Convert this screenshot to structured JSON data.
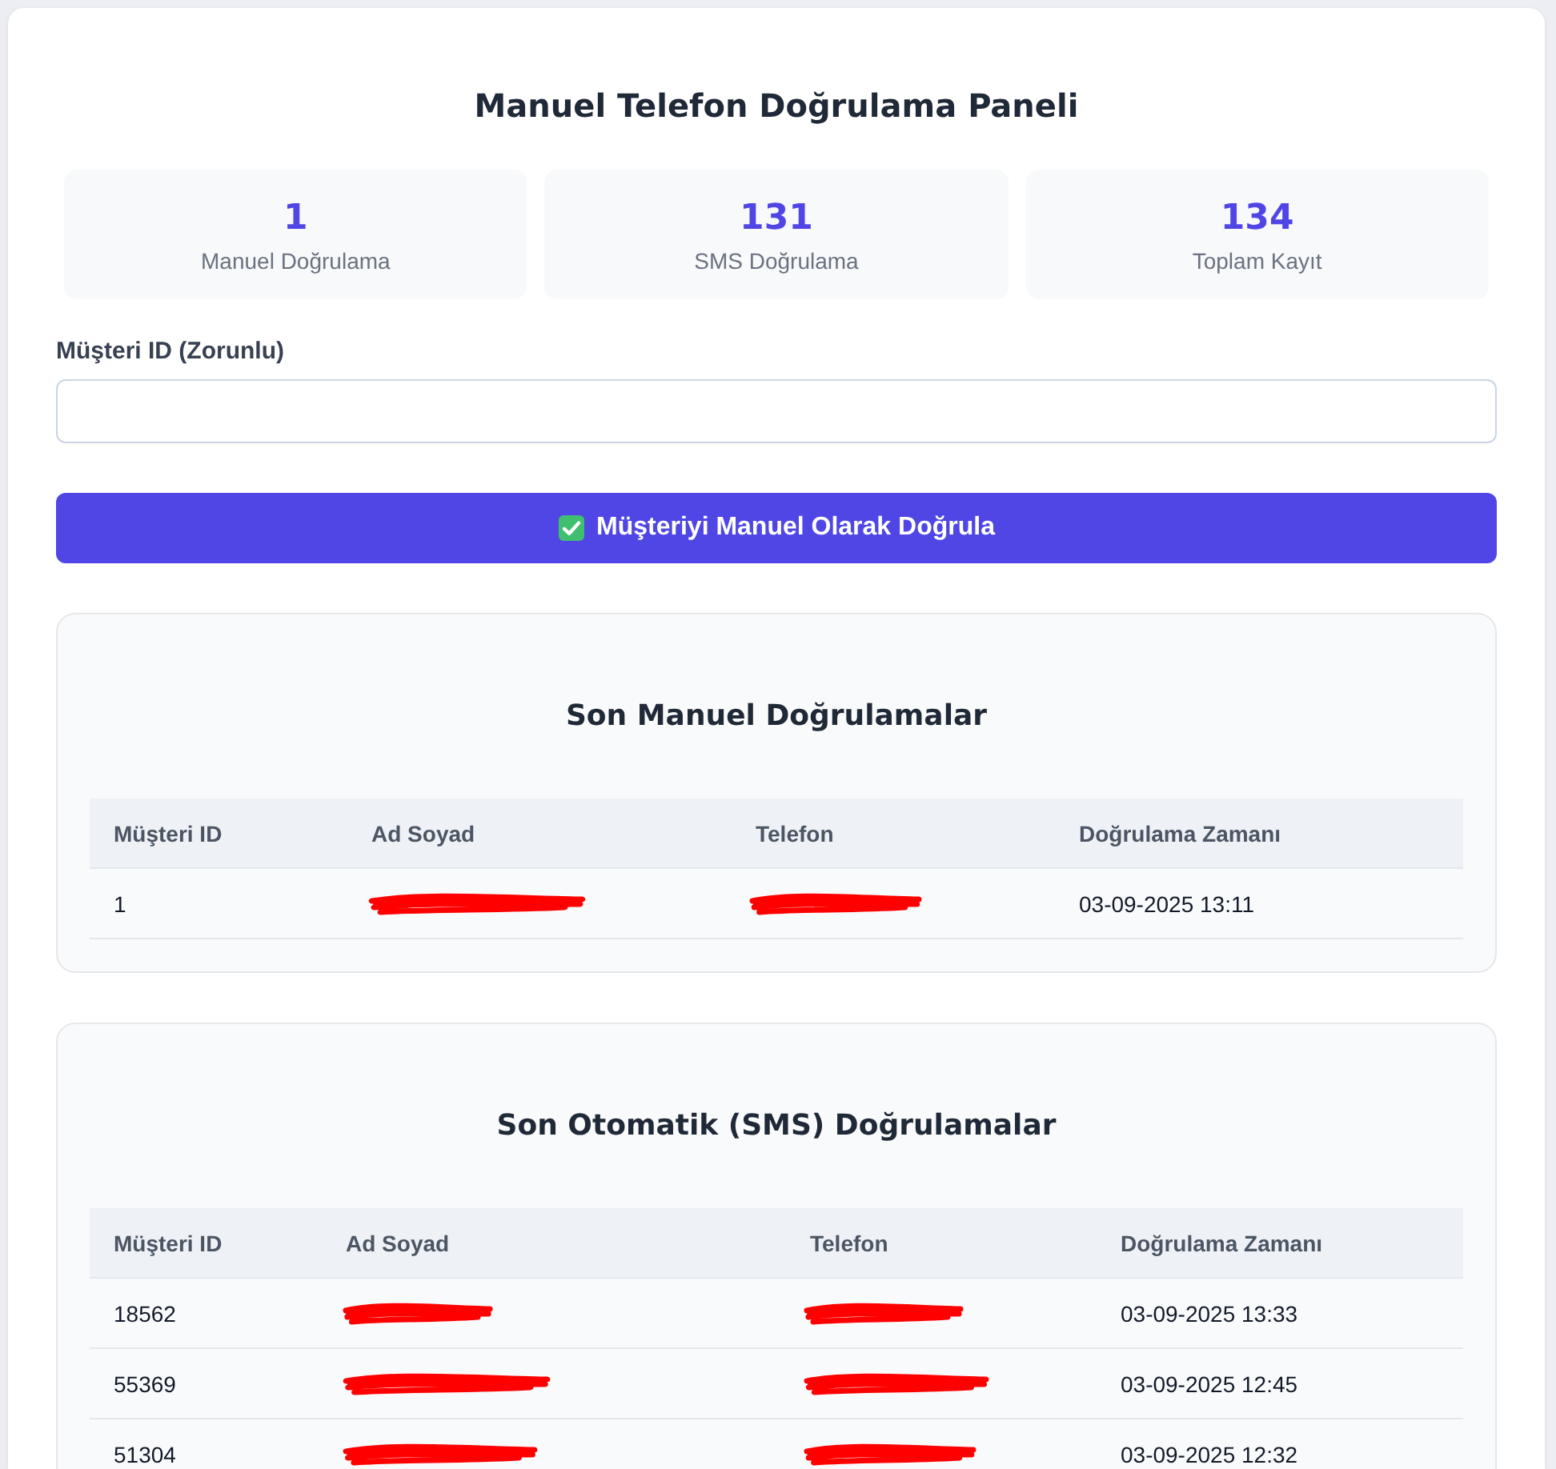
{
  "title": "Manuel Telefon Doğrulama Paneli",
  "stats": [
    {
      "value": "1",
      "label": "Manuel Doğrulama"
    },
    {
      "value": "131",
      "label": "SMS Doğrulama"
    },
    {
      "value": "134",
      "label": "Toplam Kayıt"
    }
  ],
  "form": {
    "label": "Müşteri ID (Zorunlu)"
  },
  "submit_button": {
    "label": "Müşteriyi Manuel Olarak Doğrula"
  },
  "sections": [
    {
      "title": "Son Manuel Doğrulamalar",
      "columns": [
        "Müşteri ID",
        "Ad Soyad",
        "Telefon",
        "Doğrulama Zamanı"
      ],
      "rows": [
        {
          "cells": [
            {
              "kind": "text",
              "text": "1"
            },
            {
              "kind": "redacted"
            },
            {
              "kind": "redacted"
            },
            {
              "kind": "text",
              "text": "03-09-2025 13:11"
            }
          ]
        }
      ]
    },
    {
      "title": "Son Otomatik (SMS) Doğrulamalar",
      "columns": [
        "Müşteri ID",
        "Ad Soyad",
        "Telefon",
        "Doğrulama Zamanı"
      ],
      "rows": [
        {
          "cells": [
            {
              "kind": "text",
              "text": "18562"
            },
            {
              "kind": "redacted"
            },
            {
              "kind": "redacted"
            },
            {
              "kind": "text",
              "text": "03-09-2025 13:33"
            }
          ]
        },
        {
          "cells": [
            {
              "kind": "text",
              "text": "55369"
            },
            {
              "kind": "redacted"
            },
            {
              "kind": "redacted"
            },
            {
              "kind": "text",
              "text": "03-09-2025 12:45"
            }
          ]
        },
        {
          "cells": [
            {
              "kind": "text",
              "text": "51304"
            },
            {
              "kind": "redacted"
            },
            {
              "kind": "redacted"
            },
            {
              "kind": "text",
              "text": "03-09-2025 12:32"
            }
          ]
        }
      ]
    }
  ]
}
